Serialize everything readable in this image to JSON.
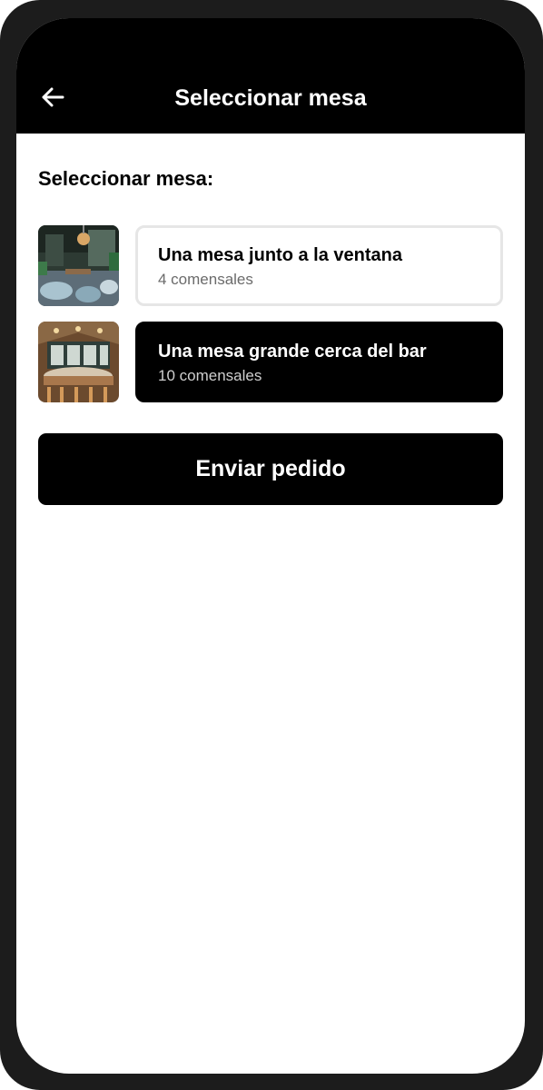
{
  "header": {
    "title": "Seleccionar mesa",
    "back_icon": "arrow-left-icon"
  },
  "section_title": "Seleccionar mesa:",
  "tables": [
    {
      "name": "Una mesa junto a la ventana",
      "guests": "4 comensales",
      "selected": false
    },
    {
      "name": "Una mesa grande cerca del bar",
      "guests": "10 comensales",
      "selected": true
    }
  ],
  "submit_label": "Enviar pedido",
  "colors": {
    "header_bg": "#000000",
    "accent": "#000000",
    "card_border": "#e6e6e6",
    "frame": "#1c1c1c"
  }
}
